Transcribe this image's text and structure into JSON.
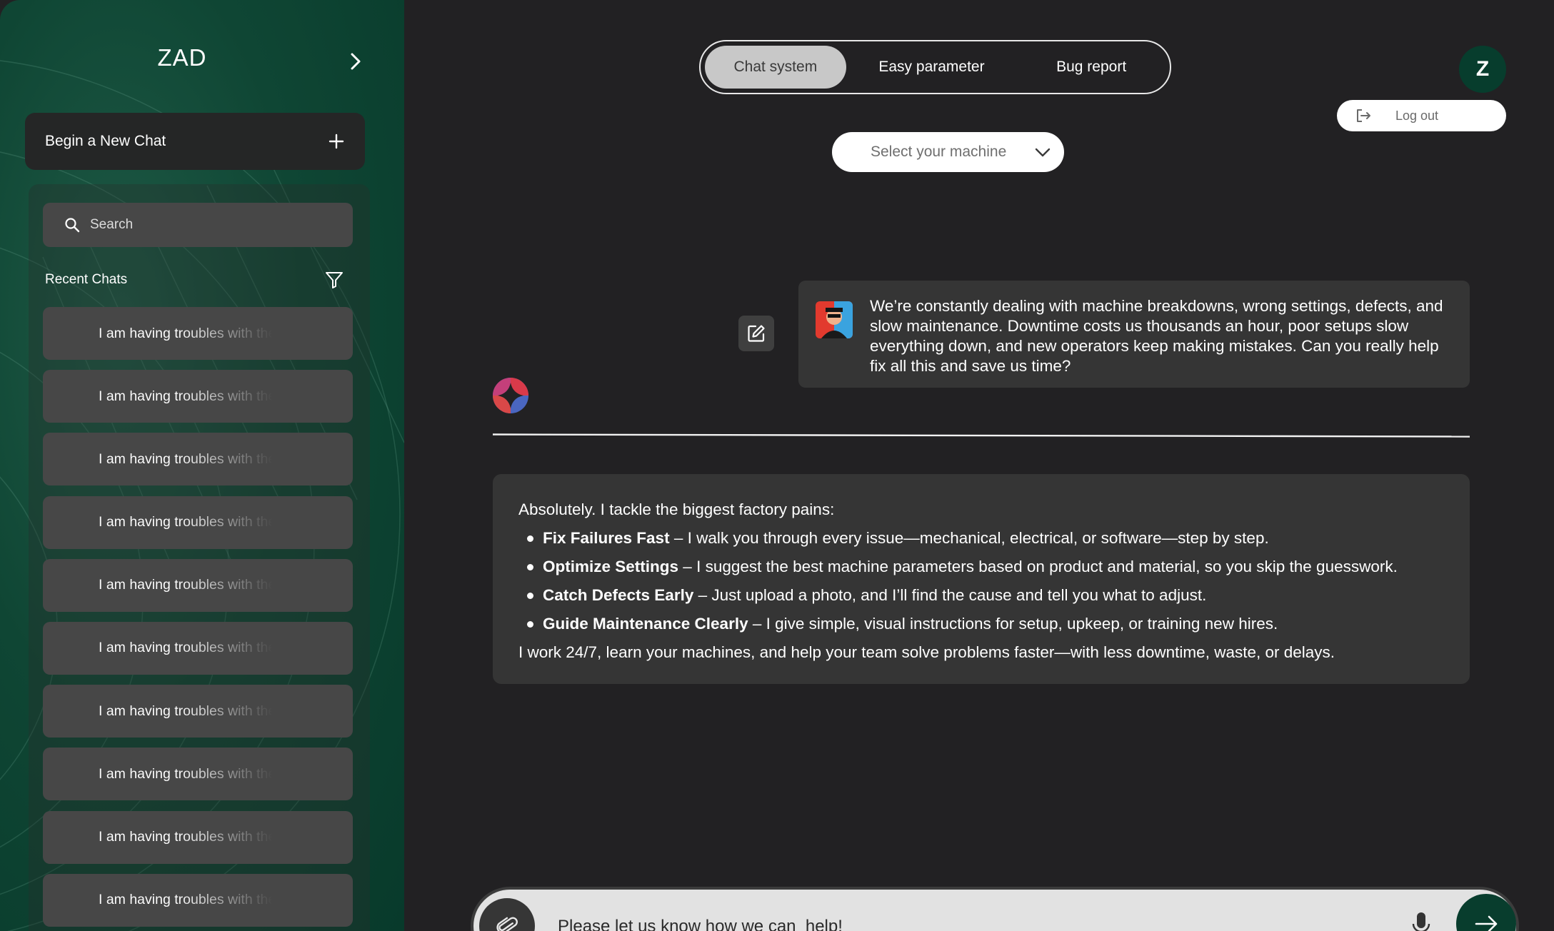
{
  "sidebar": {
    "brand": "ZAD",
    "new_chat_label": "Begin a New Chat",
    "search_placeholder": "Search",
    "recent_title": "Recent Chats",
    "chats": [
      "I am having troubles with the",
      "I am having troubles with the",
      "I am having troubles with the",
      "I am having troubles with the",
      "I am having troubles with the",
      "I am having troubles with the",
      "I am having troubles with the",
      "I am having troubles with the",
      "I am having troubles with the",
      "I am having troubles with the"
    ]
  },
  "header": {
    "tabs": [
      {
        "label": "Chat system",
        "active": true
      },
      {
        "label": "Easy parameter",
        "active": false
      },
      {
        "label": "Bug report",
        "active": false
      }
    ],
    "avatar_initial": "Z",
    "logout_label": "Log out",
    "machine_select_placeholder": "Select your machine"
  },
  "conversation": {
    "user_message": "We’re constantly dealing with machine breakdowns, wrong settings, defects, and slow maintenance. Downtime costs us thousands an hour, poor setups slow everything down, and new operators keep making mistakes. Can you really help fix all this and save us time?",
    "assistant": {
      "intro": "Absolutely. I tackle the biggest factory pains:",
      "points": [
        {
          "title": "Fix Failures Fast",
          "sep": " – ",
          "text": "I walk you through every issue—mechanical, electrical, or software—step by step."
        },
        {
          "title": "Optimize Settings",
          "sep": " – ",
          "text": "I suggest the best machine parameters based on product and material, so you skip the guesswork."
        },
        {
          "title": "Catch Defects Early",
          "sep": " – ",
          "text": "Just upload a photo, and I’ll find the cause and tell you what to adjust."
        },
        {
          "title": "Guide Maintenance Clearly",
          "sep": " – ",
          "text": "I give simple, visual instructions for setup, upkeep, or training new hires."
        }
      ],
      "outro": "I work 24/7, learn your machines, and help your team solve problems faster—with less downtime, waste, or delays."
    }
  },
  "composer": {
    "placeholder": "Please let us know how we can  help!"
  },
  "colors": {
    "sidebar_green": "#0f4634",
    "accent_green": "#083d2d",
    "main_bg": "#222123",
    "bubble_bg": "#353535",
    "chat_item_bg": "#474747"
  },
  "icons": [
    "chevron-right-icon",
    "plus-icon",
    "search-icon",
    "filter-icon",
    "logout-icon",
    "chevron-down-icon",
    "edit-icon",
    "bot-logo-icon",
    "paperclip-icon",
    "microphone-icon",
    "arrow-right-icon"
  ]
}
